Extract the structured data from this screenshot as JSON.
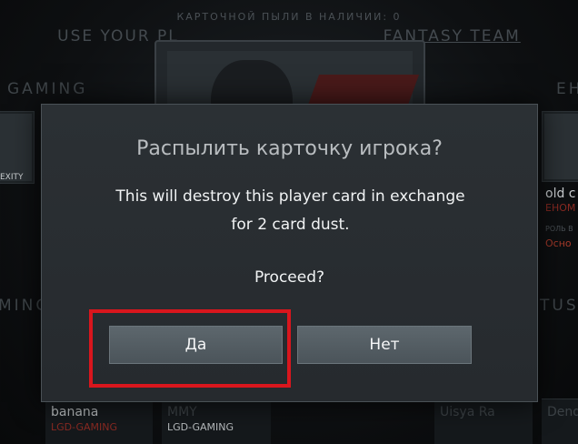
{
  "header": {
    "dust_count": "КАРТОЧНОЙ ПЫЛИ В НАЛИЧИИ: 0",
    "instruction_prefix": "USE YOUR PL",
    "instruction_link": "FANTASY TEAM"
  },
  "background": {
    "left_section_title": "GAMING",
    "right_section_title": "EHO",
    "left_section_title_2": "MING",
    "right_section_title_2": "TUS",
    "left_card_team_label": "EXITY",
    "right_card_name": "old c",
    "right_card_team": "EHOM",
    "right_card_role": "РОЛЬ В",
    "right_card_role_value": "Осно",
    "bottom_cards": [
      {
        "name": "banana",
        "team": "LGD-GAMING"
      },
      {
        "name": "MMY",
        "team": "LGD-GAMING"
      },
      {
        "name": "Uisya Ra",
        "team": ""
      },
      {
        "name": "Dend",
        "team": ""
      }
    ]
  },
  "dialog": {
    "title": "Распылить карточку игрока?",
    "message": "This will destroy this player card in exchange for 2 card dust.",
    "proceed": "Proceed?",
    "yes_label": "Да",
    "no_label": "Нет",
    "highlight_color": "#d9161d"
  }
}
